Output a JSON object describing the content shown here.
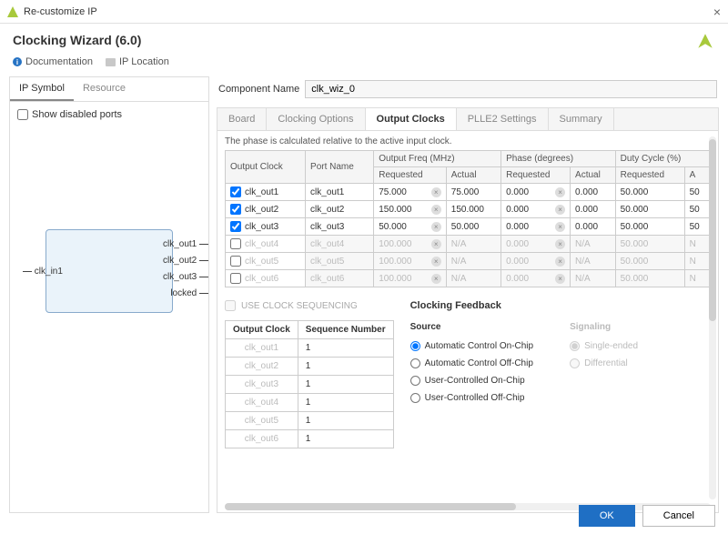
{
  "window": {
    "title": "Re-customize IP"
  },
  "header": {
    "title": "Clocking Wizard (6.0)"
  },
  "links": {
    "doc": "Documentation",
    "loc": "IP Location"
  },
  "left": {
    "tabs": {
      "symbol": "IP Symbol",
      "resource": "Resource"
    },
    "show_disabled": "Show disabled ports",
    "block": {
      "in": "clk_in1",
      "outs": [
        "clk_out1",
        "clk_out2",
        "clk_out3",
        "locked"
      ]
    }
  },
  "comp": {
    "label": "Component Name",
    "value": "clk_wiz_0"
  },
  "tabs": {
    "board": "Board",
    "clocking": "Clocking Options",
    "output": "Output Clocks",
    "plle2": "PLLE2 Settings",
    "summary": "Summary"
  },
  "note": "The phase is calculated relative to the active input clock.",
  "grid": {
    "group_freq": "Output Freq (MHz)",
    "group_phase": "Phase (degrees)",
    "group_duty": "Duty Cycle (%)",
    "h_oc": "Output Clock",
    "h_pn": "Port Name",
    "h_req": "Requested",
    "h_act": "Actual",
    "rows": [
      {
        "en": true,
        "oc": "clk_out1",
        "pn": "clk_out1",
        "freq_r": "75.000",
        "freq_a": "75.000",
        "ph_r": "0.000",
        "ph_a": "0.000",
        "dc_r": "50.000",
        "dc_a": "50"
      },
      {
        "en": true,
        "oc": "clk_out2",
        "pn": "clk_out2",
        "freq_r": "150.000",
        "freq_a": "150.000",
        "ph_r": "0.000",
        "ph_a": "0.000",
        "dc_r": "50.000",
        "dc_a": "50"
      },
      {
        "en": true,
        "oc": "clk_out3",
        "pn": "clk_out3",
        "freq_r": "50.000",
        "freq_a": "50.000",
        "ph_r": "0.000",
        "ph_a": "0.000",
        "dc_r": "50.000",
        "dc_a": "50"
      },
      {
        "en": false,
        "oc": "clk_out4",
        "pn": "clk_out4",
        "freq_r": "100.000",
        "freq_a": "N/A",
        "ph_r": "0.000",
        "ph_a": "N/A",
        "dc_r": "50.000",
        "dc_a": "N"
      },
      {
        "en": false,
        "oc": "clk_out5",
        "pn": "clk_out5",
        "freq_r": "100.000",
        "freq_a": "N/A",
        "ph_r": "0.000",
        "ph_a": "N/A",
        "dc_r": "50.000",
        "dc_a": "N"
      },
      {
        "en": false,
        "oc": "clk_out6",
        "pn": "clk_out6",
        "freq_r": "100.000",
        "freq_a": "N/A",
        "ph_r": "0.000",
        "ph_a": "N/A",
        "dc_r": "50.000",
        "dc_a": "N"
      }
    ]
  },
  "seq": {
    "title": "USE CLOCK SEQUENCING",
    "h_oc": "Output Clock",
    "h_sn": "Sequence Number",
    "rows": [
      {
        "oc": "clk_out1",
        "sn": "1"
      },
      {
        "oc": "clk_out2",
        "sn": "1"
      },
      {
        "oc": "clk_out3",
        "sn": "1"
      },
      {
        "oc": "clk_out4",
        "sn": "1"
      },
      {
        "oc": "clk_out5",
        "sn": "1"
      },
      {
        "oc": "clk_out6",
        "sn": "1"
      }
    ]
  },
  "feedback": {
    "title": "Clocking Feedback",
    "source": "Source",
    "signaling": "Signaling",
    "src_opts": [
      "Automatic Control On-Chip",
      "Automatic Control Off-Chip",
      "User-Controlled On-Chip",
      "User-Controlled Off-Chip"
    ],
    "sig_opts": [
      "Single-ended",
      "Differential"
    ]
  },
  "buttons": {
    "ok": "OK",
    "cancel": "Cancel"
  }
}
